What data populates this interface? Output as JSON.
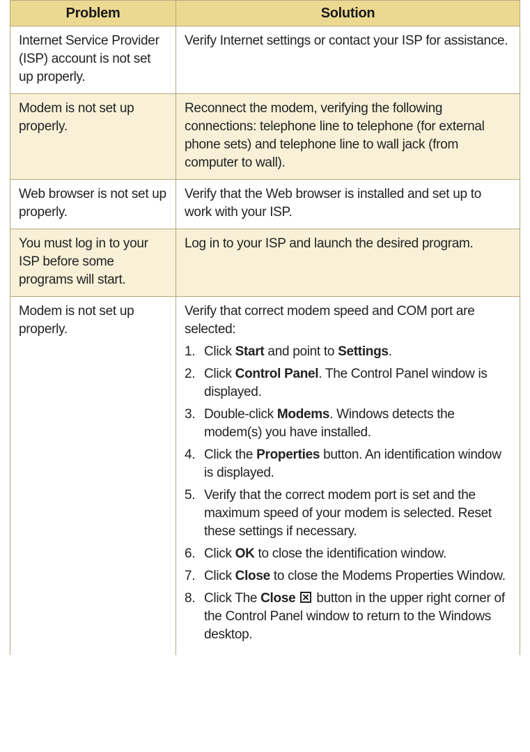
{
  "table": {
    "headers": [
      "Problem",
      "Solution"
    ],
    "rows": [
      {
        "problem": "Internet Service Provider (ISP) account is not set up properly.",
        "solution": "Verify Internet settings or contact your ISP for assistance."
      },
      {
        "problem": "Modem is not set up properly.",
        "solution": "Reconnect the modem, verifying the following connections: telephone line to telephone (for external phone sets) and telephone line to wall jack (from computer to wall)."
      },
      {
        "problem": "Web browser is not set up properly.",
        "solution": "Verify that the Web browser is installed and set up to work with your ISP."
      },
      {
        "problem": "You must log in to your ISP before some programs will start.",
        "solution": "Log in to your ISP and launch the desired program."
      }
    ],
    "last_row": {
      "problem": "Modem is not set up properly.",
      "intro": "Verify that correct modem speed and COM port are selected:",
      "steps": [
        {
          "n": "1.",
          "a": "Click ",
          "b1": "Start",
          "c": " and point to ",
          "b2": "Settings",
          "d": "."
        },
        {
          "n": "2.",
          "a": "Click ",
          "b1": "Control Panel",
          "c": ". The Control Panel window is displayed."
        },
        {
          "n": "3.",
          "a": "Double-click ",
          "b1": "Modems",
          "c": ". Windows detects the modem(s) you have installed."
        },
        {
          "n": "4.",
          "a": "Click the ",
          "b1": "Properties",
          "c": " button. An identification window is displayed."
        },
        {
          "n": "5.",
          "a": "Verify that the correct modem port is set and the maximum speed of your modem is selected. Reset these settings if necessary."
        },
        {
          "n": "6.",
          "a": "Click ",
          "b1": "OK",
          "c": " to close the identification window."
        },
        {
          "n": "7.",
          "a": "Click ",
          "b1": "Close",
          "c": " to close the Modems Properties Window."
        },
        {
          "n": "8.",
          "a": "Click The ",
          "b1": "Close",
          "c": " button in the upper right corner of the Control Panel window to return to the Windows desktop."
        }
      ]
    }
  }
}
